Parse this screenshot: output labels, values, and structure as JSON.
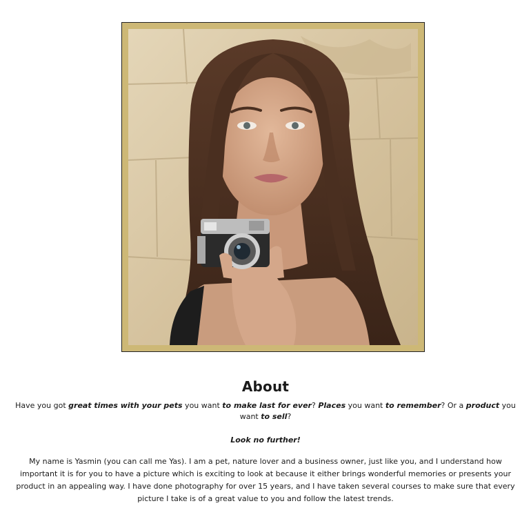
{
  "portrait": {
    "alt": "Woman holding a vintage camera",
    "frame_color": "#cdb876"
  },
  "about": {
    "title": "About",
    "intro": {
      "p1": "Have you got ",
      "b1": "great times with your pets",
      "p2": " you want ",
      "b2": "to make last for ever",
      "p3": "? ",
      "b3": "Places",
      "p4": " you want ",
      "b4": "to remember",
      "p5": "? Or a ",
      "b5": "product",
      "p6": " you want ",
      "b6": "to sell",
      "p7": "?"
    },
    "look_further": "Look no further!",
    "bio": "My name is Yasmin (you can call me Yas). I am a pet, nature lover and a business owner, just like you, and I understand how important it is for you to have a picture which is exciting to look at because it either brings wonderful memories or presents your product in an appealing way. I have done photography for over 15 years, and I have taken several courses to make sure that every picture I take is of a great value to you and follow the latest trends."
  }
}
